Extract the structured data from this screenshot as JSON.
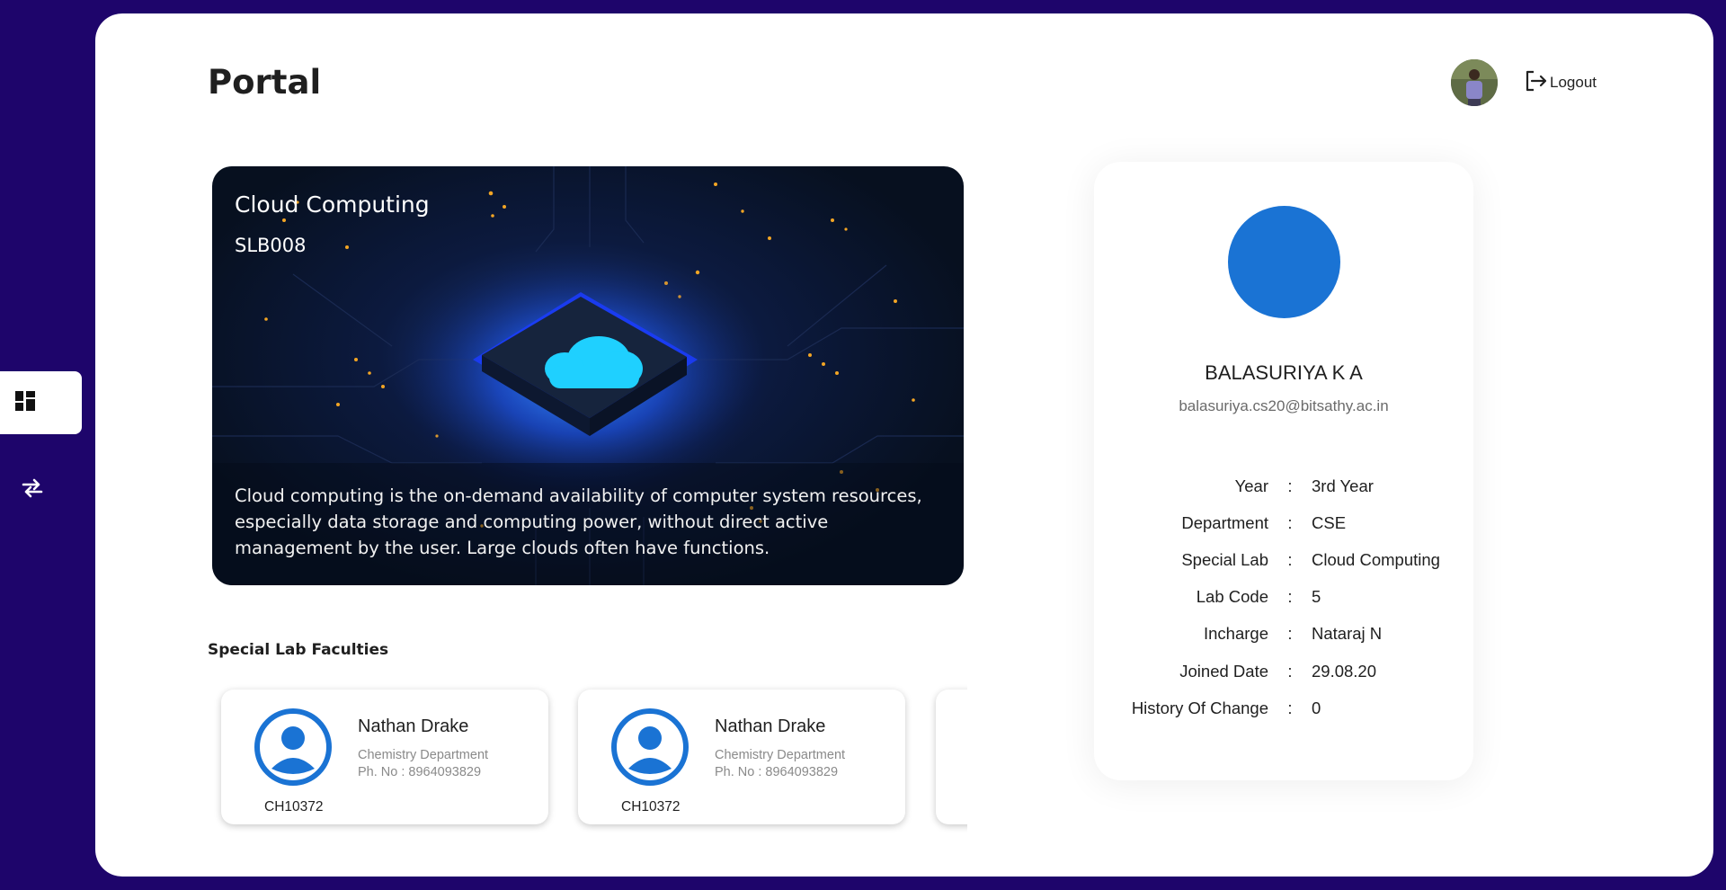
{
  "nav": {
    "items": [
      {
        "name": "dashboard",
        "icon": "dashboard-icon",
        "active": true
      },
      {
        "name": "switch",
        "icon": "swap-arrows-icon",
        "active": false
      }
    ]
  },
  "header": {
    "title": "Portal",
    "logout_label": "Logout"
  },
  "course": {
    "title": "Cloud Computing",
    "code": "SLB008",
    "description": "Cloud computing is the on-demand availability of computer system resources, especially data storage and computing power, without direct active management by the user. Large clouds often have functions."
  },
  "faculties": {
    "heading": "Special Lab Faculties",
    "items": [
      {
        "name": "Nathan Drake",
        "department": "Chemistry Department",
        "phone": "Ph. No : 8964093829",
        "id": "CH10372"
      },
      {
        "name": "Nathan Drake",
        "department": "Chemistry Department",
        "phone": "Ph. No : 8964093829",
        "id": "CH10372"
      },
      {
        "name": "",
        "department": "",
        "phone": "",
        "id": ""
      }
    ]
  },
  "profile": {
    "name": "BALASURIYA K A",
    "email": "balasuriya.cs20@bitsathy.ac.in",
    "rows": [
      {
        "label": "Year",
        "value": "3rd Year"
      },
      {
        "label": "Department",
        "value": "CSE"
      },
      {
        "label": "Special Lab",
        "value": "Cloud Computing"
      },
      {
        "label": "Lab Code",
        "value": "5"
      },
      {
        "label": "Incharge",
        "value": "Nataraj N"
      },
      {
        "label": "Joined Date",
        "value": "29.08.20"
      },
      {
        "label": "History Of Change",
        "value": "0"
      }
    ],
    "separator": ":"
  },
  "colors": {
    "background": "#1e056b",
    "accent": "#1a73d4",
    "panel": "#ffffff"
  }
}
